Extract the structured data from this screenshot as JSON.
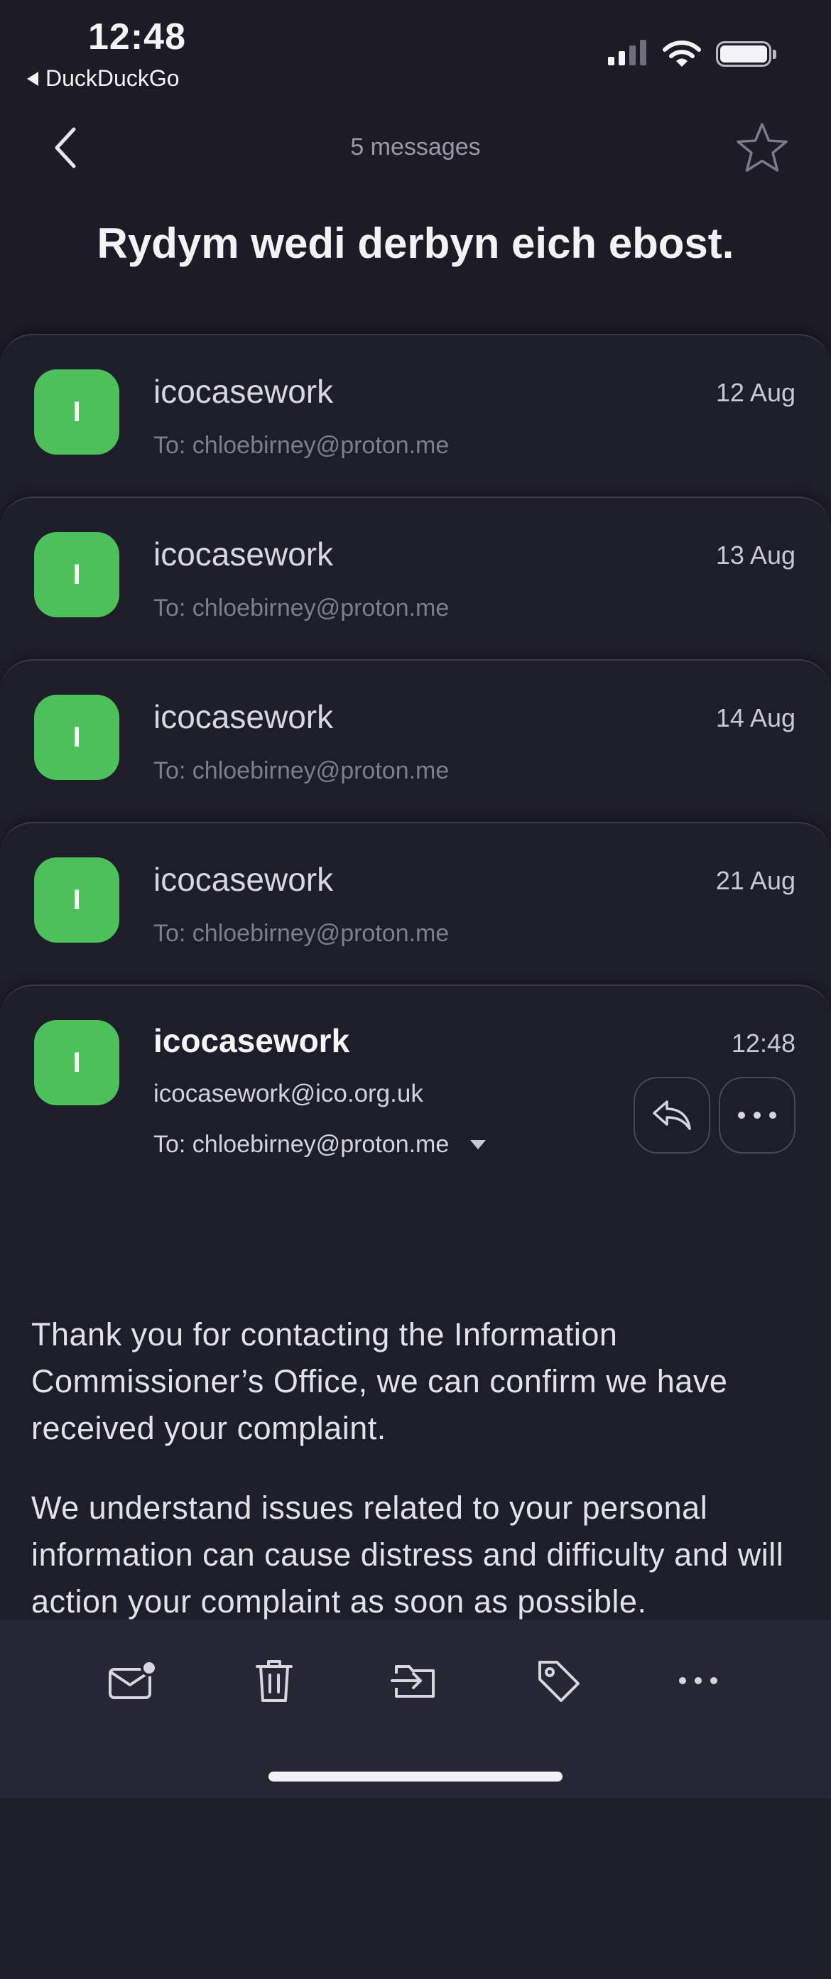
{
  "status_bar": {
    "time": "12:48",
    "back_app": "DuckDuckGo",
    "icons": [
      "cellular-signal-icon",
      "wifi-icon",
      "battery-icon"
    ]
  },
  "nav": {
    "title": "5 messages",
    "back_icon": "chevron-left-icon",
    "star_icon": "star-outline-icon"
  },
  "subject": "Rydym wedi derbyn eich ebost.",
  "messages": [
    {
      "avatar": "I",
      "sender": "icocasework",
      "date": "12 Aug",
      "to": "To: chloebirney@proton.me"
    },
    {
      "avatar": "I",
      "sender": "icocasework",
      "date": "13 Aug",
      "to": "To: chloebirney@proton.me"
    },
    {
      "avatar": "I",
      "sender": "icocasework",
      "date": "14 Aug",
      "to": "To: chloebirney@proton.me"
    },
    {
      "avatar": "I",
      "sender": "icocasework",
      "date": "21 Aug",
      "to": "To: chloebirney@proton.me"
    }
  ],
  "expanded": {
    "avatar": "I",
    "sender": "icocasework",
    "time": "12:48",
    "sender_email": "icocasework@ico.org.uk",
    "to": "To: chloebirney@proton.me",
    "body": [
      "Thank you for contacting the Information Commissioner’s Office, we can confirm we have received your complaint.",
      "We understand issues related to your personal information can cause distress and difficulty and will action your complaint as soon as possible."
    ]
  },
  "toolbar": {
    "icons": [
      "mark-unread-icon",
      "trash-icon",
      "move-to-folder-icon",
      "label-tag-icon",
      "more-icon"
    ]
  },
  "colors": {
    "background": "#1c1b26",
    "avatar": "#4cc15a",
    "toolbar": "#272634"
  }
}
